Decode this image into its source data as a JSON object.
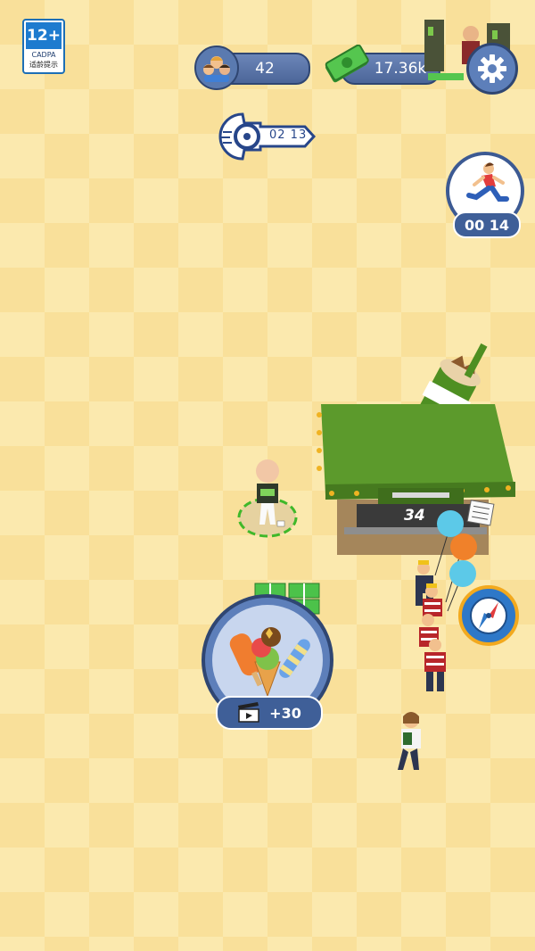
{
  "age_badge": {
    "rating": "12+",
    "org": "CADPA",
    "caption": "适龄提示"
  },
  "hud": {
    "customers": "42",
    "money": "17.36k",
    "key_timer": "02 13",
    "runner_timer": "00 14"
  },
  "stand": {
    "counter_value": "34"
  },
  "reward": {
    "video_bonus": "+30"
  },
  "colors": {
    "floor_light": "#fbe9ae",
    "floor_dark": "#f8dc90",
    "hud_blue": "#4c6699",
    "stand_green": "#5c9a2c",
    "money_green": "#4cc24a"
  },
  "icons": [
    "customers-icon",
    "cash-icon",
    "settings-gear-icon",
    "speed-key-icon",
    "runner-icon",
    "compass-icon",
    "ice-cream-icon",
    "video-clapper-icon"
  ]
}
